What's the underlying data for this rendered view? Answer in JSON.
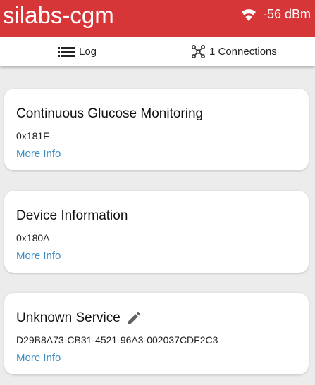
{
  "header": {
    "title": "silabs-cgm",
    "rssi": "-56 dBm",
    "signal_icon": "wifi-icon",
    "background_color": "#d63638"
  },
  "toolbar": {
    "log_label": "Log",
    "log_icon": "list-icon",
    "connections_label": "1 Connections",
    "connections_icon": "connections-icon"
  },
  "services": [
    {
      "name": "Continuous Glucose Monitoring",
      "uuid": "0x181F",
      "more_label": "More Info"
    },
    {
      "name": "Device Information",
      "uuid": "0x180A",
      "more_label": "More Info"
    },
    {
      "name": "Unknown Service",
      "uuid": "D29B8A73-CB31-4521-96A3-002037CDF2C3",
      "more_label": "More Info",
      "edit_icon": "pencil-icon"
    }
  ],
  "colors": {
    "accent_link": "#3b8ec7",
    "page_background": "#ececec"
  }
}
